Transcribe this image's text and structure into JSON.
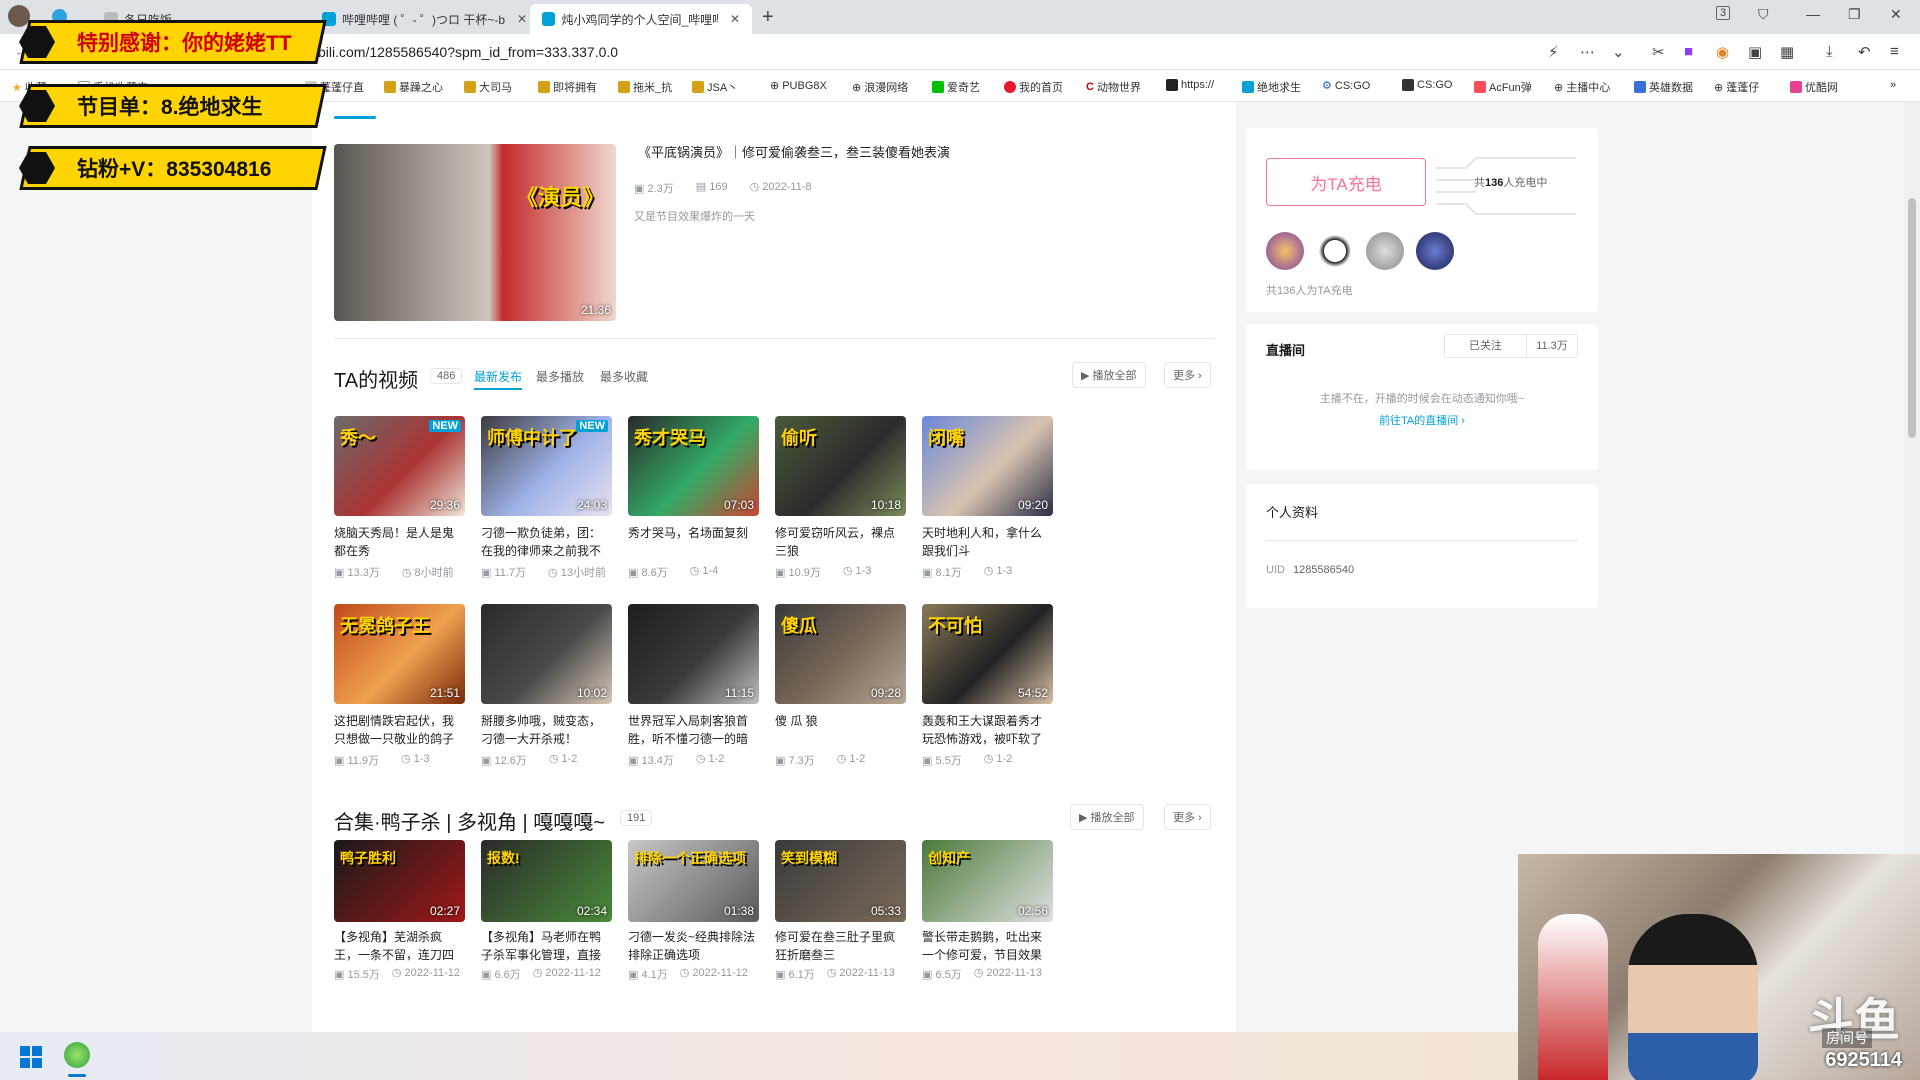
{
  "browser": {
    "tabs": [
      {
        "label": "冬日吃饭"
      },
      {
        "label": "哔哩哔哩 ( ゜- ゜)つロ 干杯~-b"
      },
      {
        "label": "炖小鸡同学的个人空间_哔哩哔"
      }
    ],
    "new_tab": "+",
    "tab_counter": "3",
    "url": "bili.com/1285586540?spm_id_from=333.337.0.0",
    "bookmarks": [
      "收藏",
      "手机收藏夹",
      "蓬蓬仔直",
      "暴躁之心",
      "大司马",
      "即将拥有",
      "拖米_抗",
      "JSA丶",
      "PUBG8X",
      "浪漫网络",
      "爱奇艺",
      "我的首页",
      "动物世界",
      "https://",
      "绝地求生",
      "CS:GO",
      "CS:GO",
      "AcFun弹",
      "主播中心",
      "英雄数据",
      "蓬蓬仔",
      "优酷网"
    ]
  },
  "overlay": {
    "line1": "特别感谢：你的姥姥TT",
    "line2": "节目单：8.绝地求生",
    "line3": "钻粉+V：835304816"
  },
  "featured": {
    "title": "《平底锅演员》｜修可爱偷袭叁三，叁三装傻看她表演",
    "plays": "2.3万",
    "comments": "169",
    "date": "2022-11-8",
    "desc": "又是节目效果爆炸的一天",
    "duration": "21:36",
    "caption": "《演员》"
  },
  "videos_section": {
    "title": "TA的视频",
    "count": "486",
    "sort_tabs": [
      "最新发布",
      "最多播放",
      "最多收藏"
    ],
    "play_all": "播放全部",
    "more": "更多",
    "items": [
      {
        "title": "烧脑天秀局！是人是鬼都在秀",
        "plays": "13.3万",
        "meta": "8小时前",
        "duration": "29:36",
        "new": "NEW",
        "caption": "秀～"
      },
      {
        "title": "刁德一欺负徒弟，团：在我的律师来之前我不会说话",
        "plays": "11.7万",
        "meta": "13小时前",
        "duration": "24:03",
        "new": "NEW",
        "caption": "师傅中计了"
      },
      {
        "title": "秀才哭马，名场面复刻",
        "plays": "8.6万",
        "meta": "1-4",
        "duration": "07:03",
        "new": "",
        "caption": "秀才哭马"
      },
      {
        "title": "修可爱窃听风云，裸点三狼",
        "plays": "10.9万",
        "meta": "1-3",
        "duration": "10:18",
        "new": "",
        "caption": "偷听"
      },
      {
        "title": "天时地利人和，拿什么跟我们斗",
        "plays": "8.1万",
        "meta": "1-3",
        "duration": "09:20",
        "new": "",
        "caption": "闭嘴"
      },
      {
        "title": "这把剧情跌宕起伏，我只想做一只敬业的鸽子",
        "plays": "11.9万",
        "meta": "1-3",
        "duration": "21:51",
        "new": "",
        "caption": "无冕鸽子王"
      },
      {
        "title": "掰腰多帅哦，贼变态，刁德一大开杀戒！",
        "plays": "12.6万",
        "meta": "1-2",
        "duration": "10:02",
        "new": "",
        "caption": ""
      },
      {
        "title": "世界冠军入局刺客狼首胜，听不懂刁德一的暗示很急",
        "plays": "13.4万",
        "meta": "1-2",
        "duration": "11:15",
        "new": "",
        "caption": ""
      },
      {
        "title": "傻 瓜 狼",
        "plays": "7.3万",
        "meta": "1-2",
        "duration": "09:28",
        "new": "",
        "caption": "傻瓜"
      },
      {
        "title": "轰轰和王大谋跟着秀才玩恐怖游戏，被吓软了嘴还是硬的",
        "plays": "5.5万",
        "meta": "1-2",
        "duration": "54:52",
        "new": "",
        "caption": "不可怕"
      }
    ]
  },
  "collection": {
    "title": "合集·鸭子杀 | 多视角 | 嘎嘎嘎~",
    "count": "191",
    "play_all": "播放全部",
    "more": "更多",
    "items": [
      {
        "title": "【多视角】芜湖杀疯王，一条不留，连刀四个人，笑疯了",
        "plays": "15.5万",
        "date": "2022-11-12",
        "duration": "02:27",
        "caption": "鸭子胜利"
      },
      {
        "title": "【多视角】马老师在鸭子杀军事化管理，直接害死警长，场",
        "plays": "6.6万",
        "date": "2022-11-12",
        "duration": "02:34",
        "caption": "报数!"
      },
      {
        "title": "刁德一发炎~经典排除法排除正确选项",
        "plays": "4.1万",
        "date": "2022-11-12",
        "duration": "01:38",
        "caption": "排除一个正确选项"
      },
      {
        "title": "修可爱在叁三肚子里疯狂折磨叁三",
        "plays": "6.1万",
        "date": "2022-11-13",
        "duration": "05:33",
        "caption": "笑到模糊"
      },
      {
        "title": "警长带走鹅鹅，吐出来一个修可爱，节目效果爆炸",
        "plays": "6.5万",
        "date": "2022-11-13",
        "duration": "02:56",
        "caption": "创知产"
      }
    ]
  },
  "charge": {
    "button": "为TA充电",
    "total_prefix": "共",
    "total_count": "136",
    "total_suffix": "人充电中",
    "footer": "共136人为TA充电"
  },
  "live": {
    "title": "直播间",
    "followed": "已关注",
    "fans": "11.3万",
    "offline": "主播不在，开播的时候会在动态通知你哦~",
    "goto": "前往TA的直播间"
  },
  "profile": {
    "title": "个人资料",
    "uid_label": "UID",
    "uid": "1285586540"
  },
  "stream": {
    "brand": "斗鱼",
    "room_label": "房间号",
    "room": "6925114"
  },
  "colors": {
    "accent": "#00a1d6",
    "pink": "#fb7299",
    "banner": "#ffd400"
  }
}
